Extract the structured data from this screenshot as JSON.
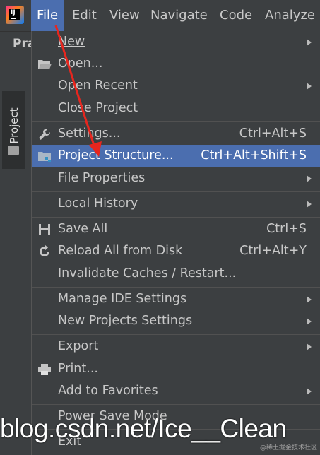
{
  "menubar": {
    "logo_text": "IJ",
    "items": [
      {
        "label": "File",
        "mnemonic": "F"
      },
      {
        "label": "Edit",
        "mnemonic": "E"
      },
      {
        "label": "View",
        "mnemonic": "V"
      },
      {
        "label": "Navigate",
        "mnemonic": "N"
      },
      {
        "label": "Code",
        "mnemonic": "C"
      },
      {
        "label": "Analyze",
        "mnemonic": ""
      }
    ]
  },
  "sidebar": {
    "project_tab": "Project",
    "title_partial": "Pra"
  },
  "file_menu": {
    "items": [
      {
        "label": "New",
        "shortcut": "",
        "submenu": true
      },
      {
        "label": "Open...",
        "shortcut": "",
        "submenu": false,
        "icon": "folder-open-icon"
      },
      {
        "label": "Open Recent",
        "shortcut": "",
        "submenu": true
      },
      {
        "label": "Close Project",
        "shortcut": "",
        "submenu": false
      },
      {
        "label": "Settings...",
        "shortcut": "Ctrl+Alt+S",
        "submenu": false,
        "icon": "wrench-icon"
      },
      {
        "label": "Project Structure...",
        "shortcut": "Ctrl+Alt+Shift+S",
        "submenu": false,
        "icon": "project-structure-icon",
        "highlighted": true
      },
      {
        "label": "File Properties",
        "shortcut": "",
        "submenu": true
      },
      {
        "label": "Local History",
        "shortcut": "",
        "submenu": true
      },
      {
        "label": "Save All",
        "shortcut": "Ctrl+S",
        "submenu": false,
        "icon": "save-icon"
      },
      {
        "label": "Reload All from Disk",
        "shortcut": "Ctrl+Alt+Y",
        "submenu": false,
        "icon": "reload-icon"
      },
      {
        "label": "Invalidate Caches / Restart...",
        "shortcut": "",
        "submenu": false
      },
      {
        "label": "Manage IDE Settings",
        "shortcut": "",
        "submenu": true
      },
      {
        "label": "New Projects Settings",
        "shortcut": "",
        "submenu": true
      },
      {
        "label": "Export",
        "shortcut": "",
        "submenu": true
      },
      {
        "label": "Print...",
        "shortcut": "",
        "submenu": false,
        "icon": "print-icon"
      },
      {
        "label": "Add to Favorites",
        "shortcut": "",
        "submenu": true
      },
      {
        "label": "Power Save Mode",
        "shortcut": "",
        "submenu": false
      },
      {
        "label": "Exit",
        "shortcut": "",
        "submenu": false
      }
    ]
  },
  "watermark": {
    "text": "blog.csdn.net/Ice__Clean",
    "small": "@稀土掘金技术社区"
  },
  "colors": {
    "highlight": "#4b6eaf",
    "background": "#3c3f41",
    "arrow": "#e8261e"
  }
}
